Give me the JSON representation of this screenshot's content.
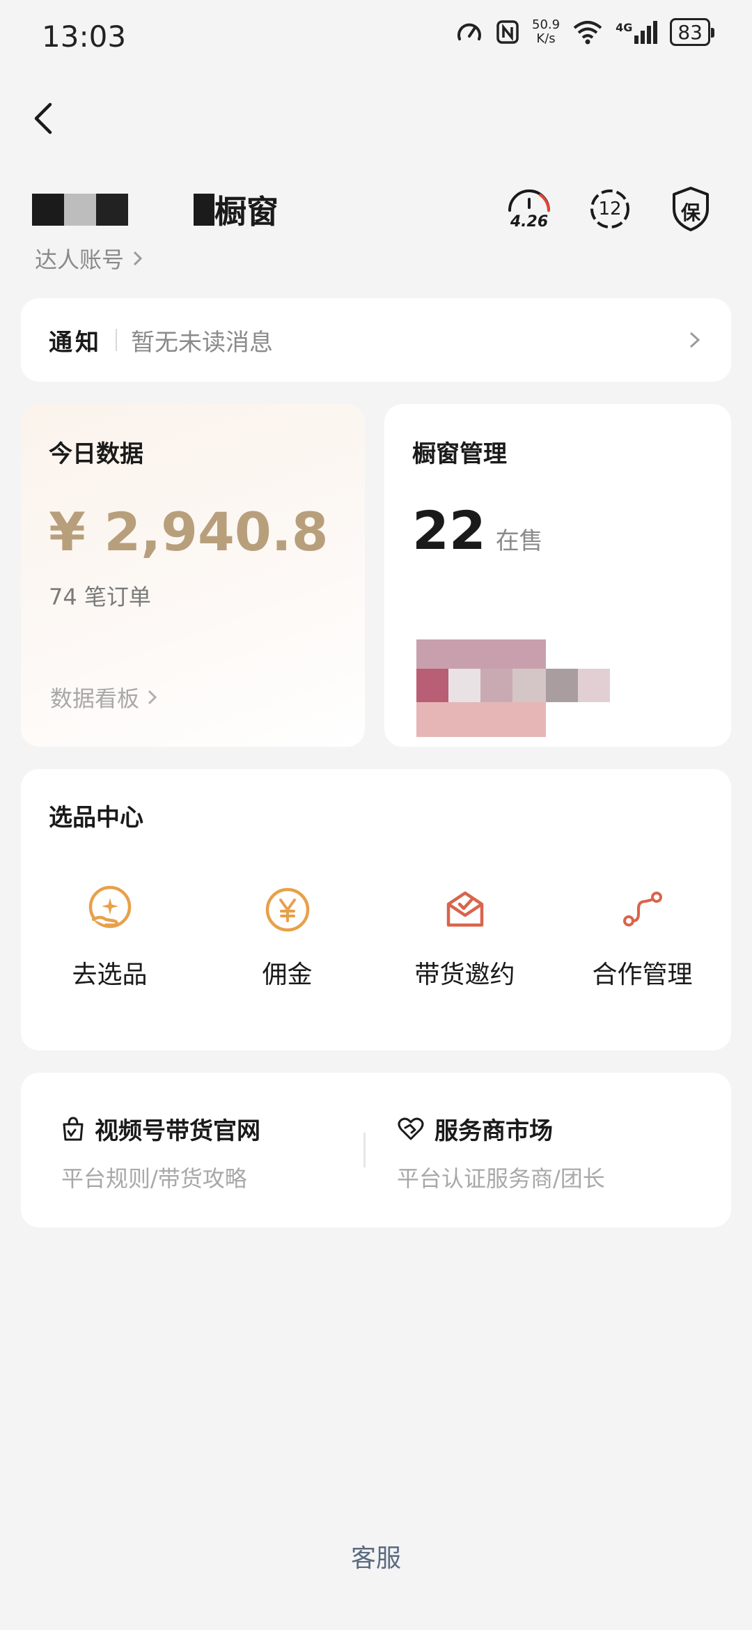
{
  "status_bar": {
    "time": "13:03",
    "net_speed_value": "50.9",
    "net_speed_unit": "K/s",
    "network": "4G",
    "battery": "83"
  },
  "header": {
    "title_suffix": "橱窗",
    "account_type": "达人账号",
    "rating": "4.26",
    "badge_count": "12",
    "shield_label": "保"
  },
  "notice": {
    "label": "通知",
    "message": "暂无未读消息"
  },
  "today": {
    "title": "今日数据",
    "amount": "¥ 2,940.8",
    "orders": "74 笔订单",
    "link": "数据看板"
  },
  "window_mgmt": {
    "title": "橱窗管理",
    "count": "22",
    "count_unit": "在售"
  },
  "selection": {
    "title": "选品中心",
    "items": [
      {
        "label": "去选品",
        "icon": "select-product-icon"
      },
      {
        "label": "佣金",
        "icon": "yen-commission-icon"
      },
      {
        "label": "带货邀约",
        "icon": "invitation-envelope-icon"
      },
      {
        "label": "合作管理",
        "icon": "cooperation-path-icon"
      }
    ]
  },
  "links": {
    "official": {
      "title": "视频号带货官网",
      "subtitle": "平台规则/带货攻略"
    },
    "market": {
      "title": "服务商市场",
      "subtitle": "平台认证服务商/团长"
    }
  },
  "footer": {
    "customer_service": "客服"
  },
  "colors": {
    "gold_amount": "#b89f7c",
    "icon_orange": "#e8a04a",
    "icon_red": "#d9644c",
    "background": "#f4f4f5"
  }
}
